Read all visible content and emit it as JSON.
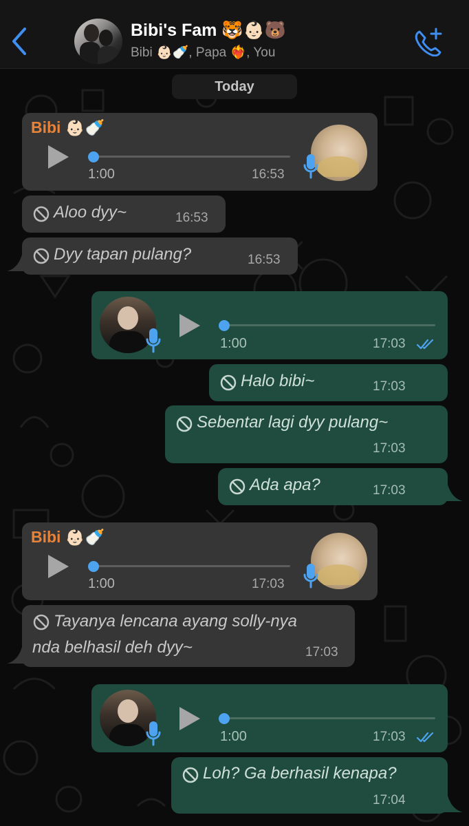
{
  "header": {
    "title": "Bibi's Fam 🐯👶🏻🐻",
    "subtitle": "Bibi 👶🏻🍼, Papa ❤️‍🔥, You"
  },
  "date_chip": "Today",
  "accent": "#4da3f0",
  "sender_color": "#e8833a",
  "messages": [
    {
      "type": "voice",
      "dir": "in",
      "sender": "Bibi",
      "sender_emoji": "👶🏻🍼",
      "duration": "1:00",
      "time": "16:53"
    },
    {
      "type": "deleted",
      "dir": "in",
      "text": "Aloo dyy~",
      "time": "16:53"
    },
    {
      "type": "deleted",
      "dir": "in",
      "text": "Dyy tapan pulang?",
      "time": "16:53"
    },
    {
      "type": "voice",
      "dir": "out",
      "duration": "1:00",
      "time": "17:03",
      "status": "read"
    },
    {
      "type": "deleted",
      "dir": "out",
      "text": "Halo bibi~",
      "time": "17:03"
    },
    {
      "type": "deleted",
      "dir": "out",
      "text": "Sebentar lagi dyy pulang~",
      "time": "17:03"
    },
    {
      "type": "deleted",
      "dir": "out",
      "text": "Ada apa?",
      "time": "17:03"
    },
    {
      "type": "voice",
      "dir": "in",
      "sender": "Bibi",
      "sender_emoji": "👶🏻🍼",
      "duration": "1:00",
      "time": "17:03"
    },
    {
      "type": "deleted",
      "dir": "in",
      "text_line1": "Tayanya lencana ayang solly-nya",
      "text_line2": "nda belhasil deh dyy~",
      "time": "17:03"
    },
    {
      "type": "voice",
      "dir": "out",
      "duration": "1:00",
      "time": "17:03",
      "status": "read"
    },
    {
      "type": "deleted",
      "dir": "out",
      "text": "Loh? Ga berhasil kenapa?",
      "time": "17:04"
    }
  ]
}
